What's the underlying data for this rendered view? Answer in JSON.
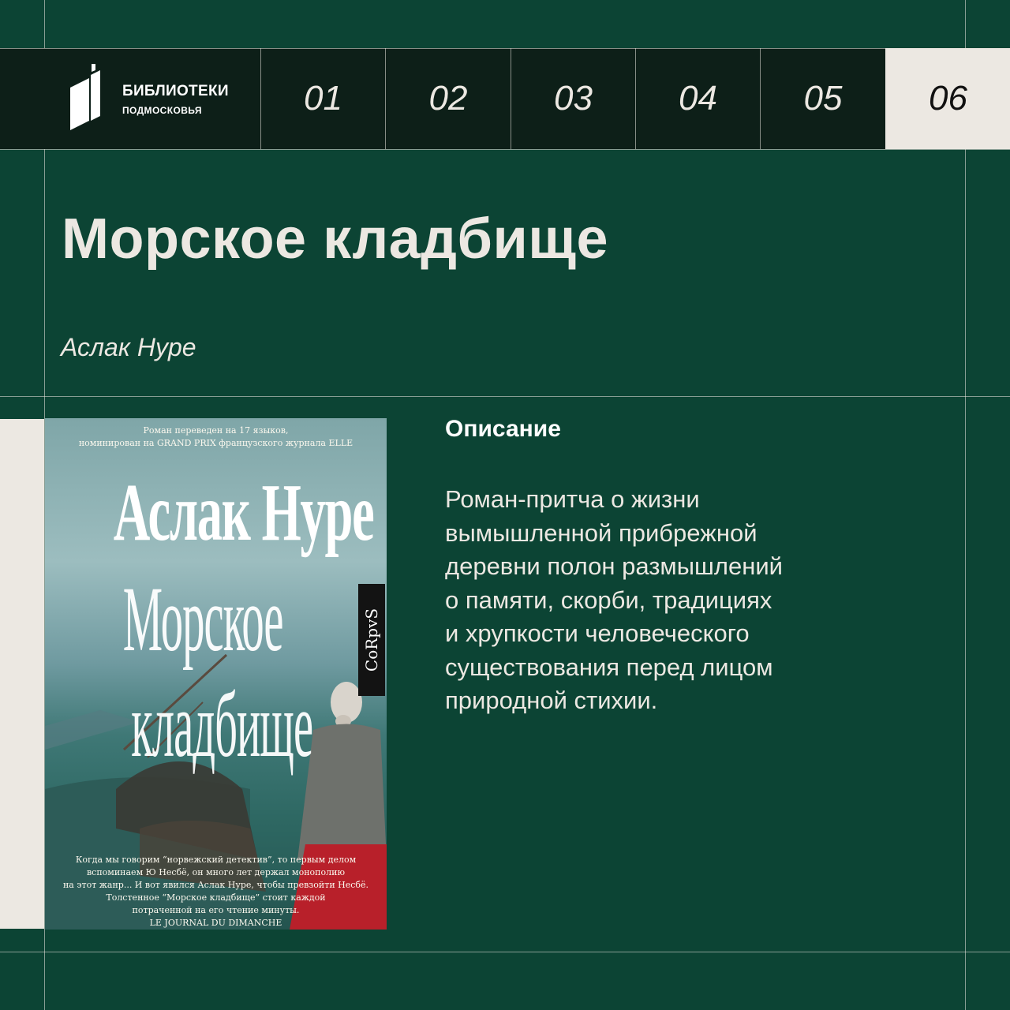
{
  "brand": {
    "title": "БИБЛИОТЕКИ",
    "subtitle": "ПОДМОСКОВЬЯ",
    "logo_icon": "book-logo-icon"
  },
  "tabs": [
    {
      "label": "01",
      "active": false
    },
    {
      "label": "02",
      "active": false
    },
    {
      "label": "03",
      "active": false
    },
    {
      "label": "04",
      "active": false
    },
    {
      "label": "05",
      "active": false
    },
    {
      "label": "06",
      "active": true
    }
  ],
  "book": {
    "title": "Морское кладбище",
    "author": "Аслак Нуре"
  },
  "cover": {
    "blurb_top": "Роман переведен на 17 языков,\nноминирован на GRAND PRIX французского журнала ELLE",
    "author": "Аслак Нуре",
    "title_line1": "Морское",
    "title_line2": "кладбище",
    "publisher": "CoRpvS",
    "blurb_bottom": "Когда мы говорим “норвежский детектив”, то первым делом\nвспоминаем Ю Несбё, он много лет держал монополию\nна этот жанр... И вот явился Аслак Нуре, чтобы превзойти Несбё.\nТолстенное “Морское кладбище” стоит каждой\nпотраченной на его чтение минуты.\nLE JOURNAL DU DIMANCHE"
  },
  "description": {
    "heading": "Описание",
    "text": "Роман-притча о жизни\nвымышленной прибрежной\nдеревни полон размышлений\nо памяти, скорби, традициях\nи хрупкости человеческого\nсуществования перед лицом\nприродной стихии."
  },
  "colors": {
    "background": "#0c4434",
    "topbar": "#0d1f18",
    "accent_light": "#ece8e2",
    "text_dark": "#111111"
  }
}
